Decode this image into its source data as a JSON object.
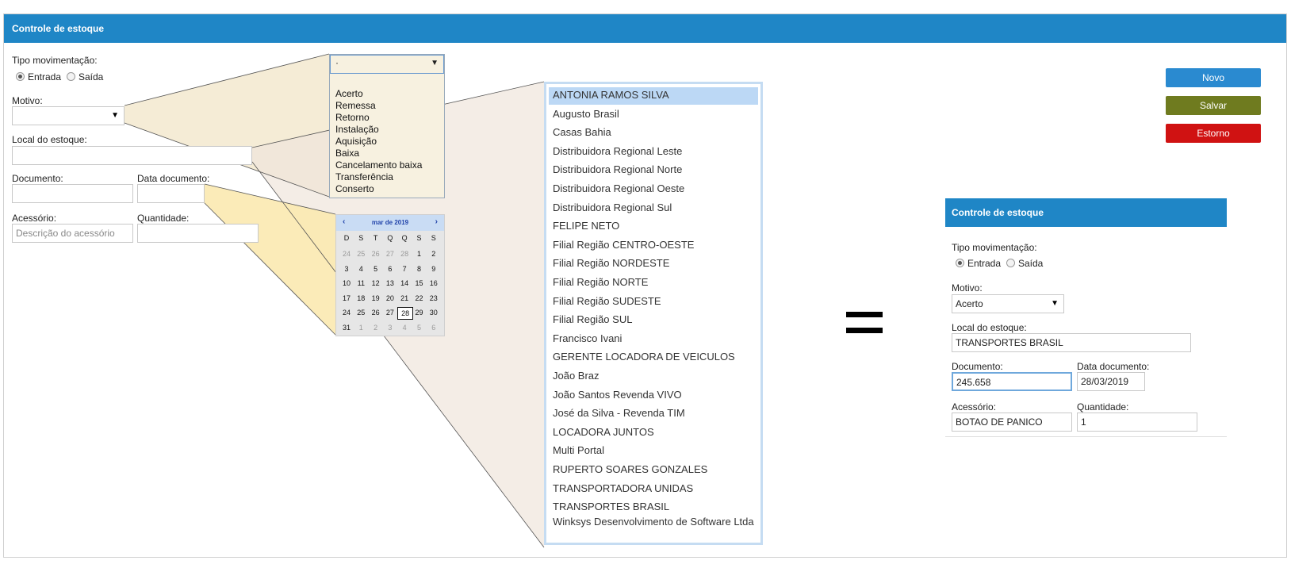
{
  "form": {
    "title": "Controle de estoque",
    "tipo_label": "Tipo movimentação:",
    "entrada_label": "Entrada",
    "saida_label": "Saída",
    "motivo_label": "Motivo:",
    "local_label": "Local do estoque:",
    "documento_label": "Documento:",
    "data_label": "Data documento:",
    "acessorio_label": "Acessório:",
    "acessorio_placeholder": "Descrição do acessório",
    "quantidade_label": "Quantidade:"
  },
  "buttons": {
    "novo": "Novo",
    "salvar": "Salvar",
    "estorno": "Estorno"
  },
  "colors": {
    "header": "#1f86c6",
    "novo": "#2a8ad0",
    "salvar": "#6f7b1f",
    "estorno": "#d01212"
  },
  "motivo_dropdown": {
    "current": "·",
    "options": [
      "Acerto",
      "Remessa",
      "Retorno",
      "Instalação",
      "Aquisição",
      "Baixa",
      "Cancelamento baixa",
      "Transferência",
      "Conserto"
    ]
  },
  "locations": [
    "ANTONIA RAMOS SILVA",
    "Augusto Brasil",
    "Casas Bahia",
    "Distribuidora Regional Leste",
    "Distribuidora Regional Norte",
    "Distribuidora Regional Oeste",
    "Distribuidora Regional Sul",
    "FELIPE NETO",
    "Filial Região CENTRO-OESTE",
    "Filial Região NORDESTE",
    "Filial Região NORTE",
    "Filial Região SUDESTE",
    "Filial Região SUL",
    "Francisco Ivani",
    "GERENTE LOCADORA DE VEICULOS",
    "João Braz",
    "João Santos Revenda VIVO",
    "José da Silva - Revenda TIM",
    "LOCADORA JUNTOS",
    "Multi Portal",
    "RUPERTO SOARES GONZALES",
    "TRANSPORTADORA UNIDAS",
    "TRANSPORTES BRASIL",
    "Winksys Desenvolvimento de Software Ltda"
  ],
  "calendar": {
    "month": "mar de 2019",
    "prev": "‹",
    "next": "›",
    "weekdays": [
      "D",
      "S",
      "T",
      "Q",
      "Q",
      "S",
      "S"
    ],
    "weeks": [
      [
        "24",
        "25",
        "26",
        "27",
        "28",
        "1",
        "2"
      ],
      [
        "3",
        "4",
        "5",
        "6",
        "7",
        "8",
        "9"
      ],
      [
        "10",
        "11",
        "12",
        "13",
        "14",
        "15",
        "16"
      ],
      [
        "17",
        "18",
        "19",
        "20",
        "21",
        "22",
        "23"
      ],
      [
        "24",
        "25",
        "26",
        "27",
        "28",
        "29",
        "30"
      ],
      [
        "31",
        "1",
        "2",
        "3",
        "4",
        "5",
        "6"
      ]
    ],
    "selected": "28"
  },
  "equals": "=",
  "result": {
    "title": "Controle de estoque",
    "tipo_label": "Tipo movimentação:",
    "entrada_label": "Entrada",
    "saida_label": "Saída",
    "motivo_label": "Motivo:",
    "motivo_value": "Acerto",
    "local_label": "Local do estoque:",
    "local_value": "TRANSPORTES BRASIL",
    "documento_label": "Documento:",
    "documento_value": "245.658",
    "data_label": "Data documento:",
    "data_value": "28/03/2019",
    "acessorio_label": "Acessório:",
    "acessorio_value": "BOTAO DE PANICO",
    "quantidade_label": "Quantidade:",
    "quantidade_value": "1"
  }
}
